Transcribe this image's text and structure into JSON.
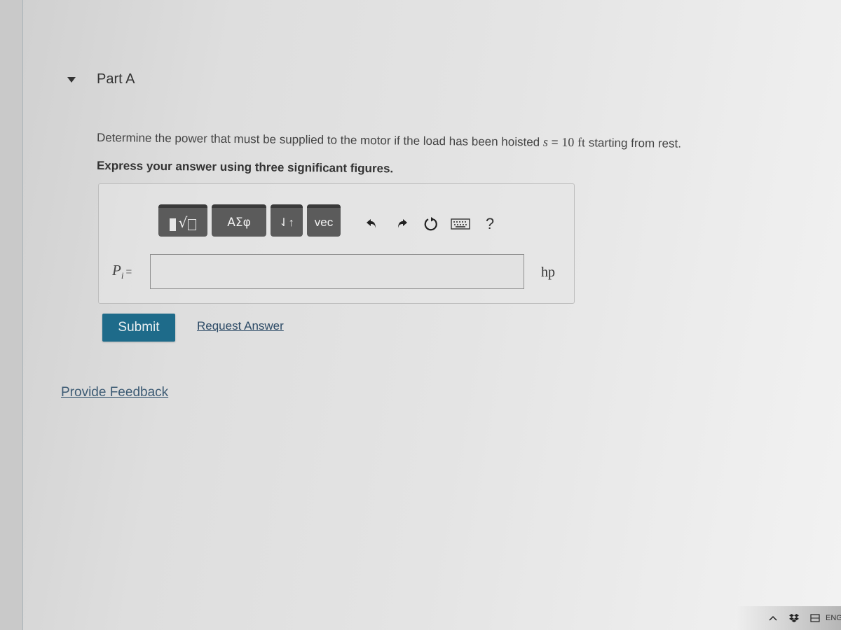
{
  "part": {
    "title": "Part A",
    "expanded": true
  },
  "question": {
    "text_before": "Determine the power that must be supplied to the motor if the load has been hoisted ",
    "variable": "s",
    "equals": " = ",
    "value": "10",
    "unit": "ft",
    "text_after": " starting from rest."
  },
  "instruction": "Express your answer using three significant figures.",
  "toolbar": {
    "templates_label": "templates",
    "templates_glyph": "√",
    "greek_label": "ΑΣφ",
    "arrows_label": "⇃↑",
    "vec_label": "vec",
    "help_label": "?"
  },
  "answer": {
    "variable": "P",
    "subscript": "i",
    "equals": "=",
    "value": "",
    "placeholder": "",
    "unit": "hp"
  },
  "actions": {
    "submit_label": "Submit",
    "request_answer_label": "Request Answer"
  },
  "feedback_label": "Provide Feedback",
  "tray": {
    "language": "ENG"
  },
  "colors": {
    "submit_bg": "#1e6b8a",
    "link": "#2c4a66",
    "toolbar_btn": "#5b5b5b"
  }
}
